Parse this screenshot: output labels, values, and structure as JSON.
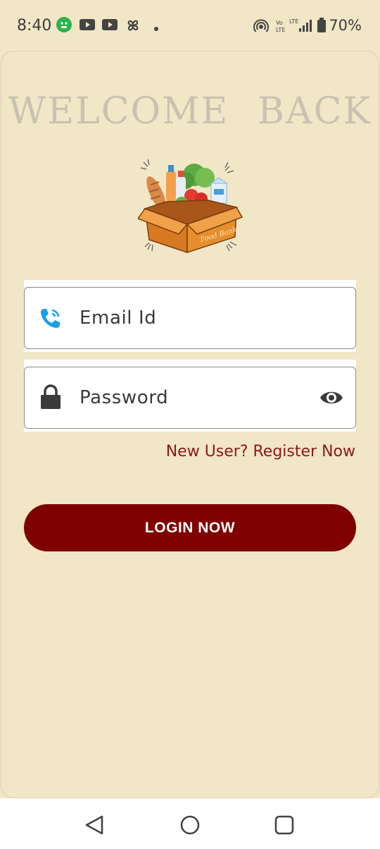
{
  "status_bar": {
    "time": "8:40",
    "battery": "70%",
    "icons": [
      "sticker-app-icon",
      "youtube-icon",
      "youtube-icon",
      "pinwheel-icon",
      "dot-icon",
      "hotspot-icon",
      "volte-icon",
      "lte-signal-icon",
      "battery-icon"
    ]
  },
  "header": {
    "title": "WELCOME  BACK"
  },
  "logo": {
    "label": "Food Bank"
  },
  "form": {
    "email_placeholder": "Email Id",
    "password_placeholder": "Password",
    "register_link": "New User? Register Now",
    "login_button": "LOGIN NOW"
  },
  "navbar": {
    "items": [
      "back-icon",
      "home-icon",
      "recents-icon"
    ]
  },
  "colors": {
    "background": "#f1e6c6",
    "accent": "#7f0000",
    "link": "#8b1a14",
    "title": "#c9c2b0",
    "phone_icon": "#1aa0e8"
  }
}
